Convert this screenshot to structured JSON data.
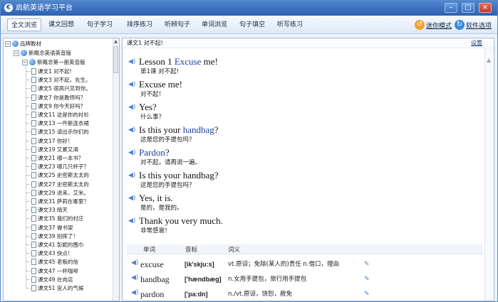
{
  "window": {
    "title": "启航英语学习平台",
    "app_icon": "€"
  },
  "menu": {
    "items": [
      "全文浏览",
      "课文回想",
      "句子学习",
      "排序练习",
      "听辨句子",
      "单词浏览",
      "句子填空",
      "听写练习"
    ],
    "mini_mode": "迷你模式",
    "settings": "软件选项"
  },
  "tree": {
    "root": "品牌教材",
    "book": "新概念英语英音版",
    "volume": "新概念第一册英音版",
    "lessons": [
      "课文1 对不起!",
      "课文3 对不起，先生。",
      "课文5 很高兴见到你。",
      "课文7 你是教师吗？",
      "课文9 你今天好吗？",
      "课文11 这是你的衬衫",
      "课文13 一件新连衣裙",
      "课文15 请出示你们的",
      "课文17 你好！",
      "课文19 又累又渴",
      "课文21 哪一本书？",
      "课文23 哪几只杯子？",
      "课文25 史密斯太太的",
      "课文27 史密斯太太的",
      "课文29 进来，艾米。",
      "课文31 萨莉在哪里？",
      "课文33 晴天",
      "课文35 我们的村庄",
      "课文37 做书架",
      "课文39 别摔了！",
      "课文41 彭妮的围巾",
      "课文43 快点！",
      "课文45 老板的信",
      "课文47 一杯咖啡",
      "课文49 在肉店",
      "课文51 宜人的气候"
    ]
  },
  "content": {
    "header_title": "课文1 对不起!",
    "settings_link": "设置",
    "lines": [
      {
        "en_parts": [
          "Lesson 1 ",
          "Excuse",
          " me!"
        ],
        "cn": "第1课 对不起!"
      },
      {
        "en_parts": [
          "Excuse me!",
          "",
          ""
        ],
        "cn": "对不起！"
      },
      {
        "en_parts": [
          "Yes?",
          "",
          ""
        ],
        "cn": "什么事？"
      },
      {
        "en_parts": [
          "Is this your ",
          "handbag",
          "?"
        ],
        "cn": "这是您的手提包吗？"
      },
      {
        "en_parts": [
          "",
          "Pardon",
          "?"
        ],
        "cn": "对不起，请再说一遍。"
      },
      {
        "en_parts": [
          "Is this your handbag?",
          "",
          ""
        ],
        "cn": "这是您的手提包吗？"
      },
      {
        "en_parts": [
          "Yes, it is.",
          "",
          ""
        ],
        "cn": "是的，是我的。"
      },
      {
        "en_parts": [
          "Thank you very much.",
          "",
          ""
        ],
        "cn": "非常感谢！"
      }
    ],
    "vocab": {
      "headers": [
        "单词",
        "音标",
        "词义"
      ],
      "rows": [
        {
          "word": "excuse",
          "phonetic": "[ik'skju:s]",
          "meaning": "vt.原谅；免除(某人的)责任 n.借口，理由"
        },
        {
          "word": "handbag",
          "phonetic": "['hændbæg]",
          "meaning": "n.女用手提包，旅行用手提包"
        },
        {
          "word": "pardon",
          "phonetic": "['pa:dn]",
          "meaning": "n./vt.原谅，饶恕，赦免"
        }
      ]
    }
  }
}
